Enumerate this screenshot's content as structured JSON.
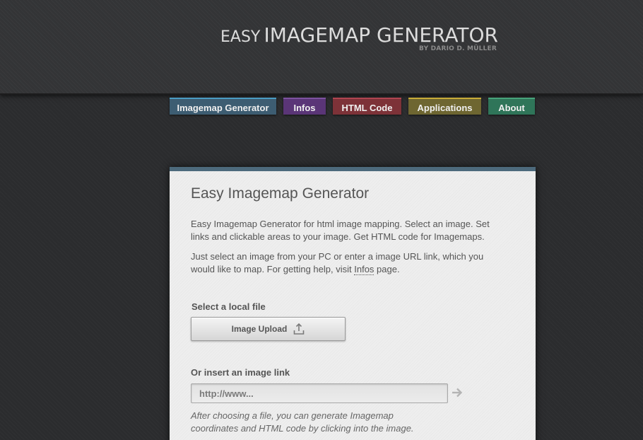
{
  "header": {
    "logo_small": "EASY",
    "logo_large": "IMAGEMAP GENERATOR",
    "byline": "BY DARIO D. MÜLLER"
  },
  "nav": {
    "items": [
      {
        "label": "Imagemap Generator",
        "color": "#3d5d72"
      },
      {
        "label": "Infos",
        "color": "#5a3577"
      },
      {
        "label": "HTML Code",
        "color": "#7d3238"
      },
      {
        "label": "Applications",
        "color": "#6e6631"
      },
      {
        "label": "About",
        "color": "#2f7559"
      }
    ]
  },
  "main": {
    "title": "Easy Imagemap Generator",
    "intro": "Easy Imagemap Generator for html image mapping. Select an image. Set links and clickable areas to your image. Get HTML code for Imagemaps.",
    "help_before": "Just select an image from your PC or enter a image URL link, which you would like to map. For getting help, visit ",
    "help_link": "Infos",
    "help_after": " page.",
    "local_file_label": "Select a local file",
    "upload_button_label": "Image Upload",
    "image_link_label": "Or insert an image link",
    "url_placeholder": "http://www...",
    "hint": "After choosing a file, you can generate Imagemap coordinates and HTML code by clicking into the image."
  },
  "icons": {
    "upload": "upload-icon",
    "go": "arrow-right-icon"
  }
}
